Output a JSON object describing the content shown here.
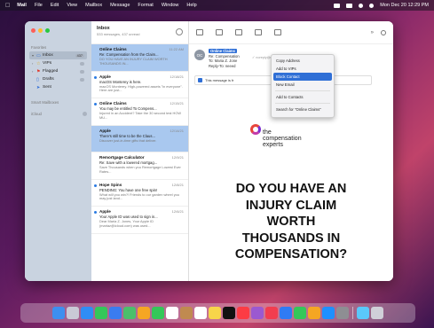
{
  "menubar": {
    "apple_icon": "apple-icon",
    "app": "Mail",
    "items": [
      "File",
      "Edit",
      "View",
      "Mailbox",
      "Message",
      "Format",
      "Window",
      "Help"
    ],
    "clock": "Mon Dec 20  12:29 PM"
  },
  "sidebar": {
    "favorites_title": "Favorites",
    "items": [
      {
        "label": "Inbox",
        "count": "437",
        "icon": "inbox-icon"
      },
      {
        "label": "VIPs",
        "count": "",
        "icon": "star-icon"
      },
      {
        "label": "Flagged",
        "count": "",
        "icon": "flag-icon"
      },
      {
        "label": "Drafts",
        "count": "",
        "icon": "draft-icon"
      },
      {
        "label": "Sent",
        "count": "",
        "icon": "send-icon"
      }
    ],
    "smart_title": "Smart Mailboxes",
    "icloud_title": "iCloud"
  },
  "list": {
    "title": "Inbox",
    "subtitle": "533 messages, 437 unread",
    "messages": [
      {
        "from": "Online Claims",
        "date": "11:22 AM",
        "subject": "Re: Compensation from the Claim...",
        "preview": "DO YOU HAVE AN INJURY CLAIM WORTH THOUSANDS IN...",
        "unread": false,
        "selected": true
      },
      {
        "from": "Apple",
        "date": "12/18/21",
        "subject": "macOS Monterey is here.",
        "preview": "macOS Monterey. High-powered assets \"in everyone\". Here are just...",
        "unread": true,
        "selected": false
      },
      {
        "from": "Online Claims",
        "date": "12/15/21",
        "subject": "You may be entitled To Compens...",
        "preview": "Injured in an Accident? Take the 30 second test HOW MU...",
        "unread": true,
        "selected": false
      },
      {
        "from": "Apple",
        "date": "12/14/21",
        "subject": "There's still time to be the Claus...",
        "preview": "Discover just-in-time gifts that deliver.",
        "unread": false,
        "selected": true
      },
      {
        "from": "Remortgage Calculator",
        "date": "12/9/21",
        "subject": "Re: Save with a lowered mortgag...",
        "preview": "Save Thousands when you Remortgage Lowest Ever Rates...",
        "unread": false,
        "selected": false
      },
      {
        "from": "Hope Spins",
        "date": "12/8/21",
        "subject": "PENDING: You have one free spin!",
        "preview": "What will you win?! Friends to our garden wheel you may just land...",
        "unread": true,
        "selected": false
      },
      {
        "from": "Apple",
        "date": "12/6/21",
        "subject": "Your Apple ID was used to sign in...",
        "preview": "Dear Maria Z. Jones, Your Apple ID (mariaz@icloud.com) was used...",
        "unread": true,
        "selected": false
      }
    ]
  },
  "reader": {
    "avatar": "OC",
    "from_chip": "Online Claims",
    "header_lines": [
      "Re: Compensation",
      "To: Maria Z. Jone",
      "Reply-To: neeed"
    ],
    "email_ghost": "✓ noreply@mh.cloud-mails.com",
    "blocked_text": "This message is fr",
    "context_menu": [
      "Copy Address",
      "Add to VIPs",
      "Block Contact",
      "New Email",
      "Add to Contacts",
      "Search for \"Online Claims\""
    ],
    "logo_text": [
      "the",
      "compensation",
      "experts"
    ],
    "headline": [
      "DO YOU HAVE AN",
      "INJURY CLAIM",
      "WORTH",
      "THOUSANDS IN",
      "COMPENSATION?"
    ]
  },
  "colors": {
    "accent": "#2f6fd6",
    "selected_row": "#a9c8ef",
    "sidebar": "#c9d3e0",
    "traffic": [
      "#fe5f57",
      "#febc2e",
      "#28c840"
    ]
  },
  "dock_icons": [
    "finder-icon",
    "launchpad-icon",
    "safari-icon",
    "messages-icon",
    "mail-icon",
    "maps-icon",
    "photos-icon",
    "facetime-icon",
    "calendar-icon",
    "contacts-icon",
    "reminders-icon",
    "notes-icon",
    "tv-icon",
    "music-icon",
    "podcasts-icon",
    "news-icon",
    "keynote-icon",
    "numbers-icon",
    "pages-icon",
    "appstore-icon",
    "settings-icon",
    "folder-icon",
    "trash-icon"
  ]
}
